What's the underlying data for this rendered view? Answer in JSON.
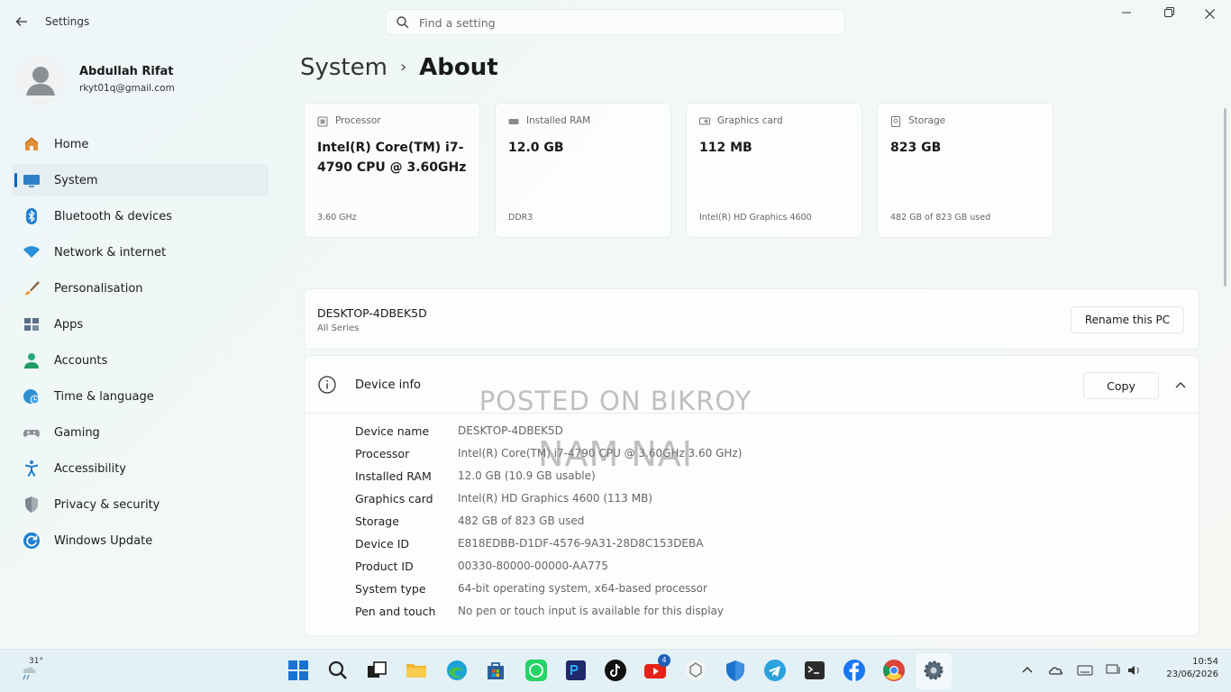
{
  "window": {
    "app_title": "Settings",
    "search_placeholder": "Find a setting"
  },
  "profile": {
    "name": "Abdullah Rifat",
    "email": "rkyt01q@gmail.com"
  },
  "sidebar": {
    "items": [
      {
        "label": "Home",
        "icon": "home-icon"
      },
      {
        "label": "System",
        "icon": "system-icon",
        "active": true
      },
      {
        "label": "Bluetooth & devices",
        "icon": "bluetooth-icon"
      },
      {
        "label": "Network & internet",
        "icon": "wifi-icon"
      },
      {
        "label": "Personalisation",
        "icon": "brush-icon"
      },
      {
        "label": "Apps",
        "icon": "apps-icon"
      },
      {
        "label": "Accounts",
        "icon": "accounts-icon"
      },
      {
        "label": "Time & language",
        "icon": "globe-clock-icon"
      },
      {
        "label": "Gaming",
        "icon": "gamepad-icon"
      },
      {
        "label": "Accessibility",
        "icon": "accessibility-icon"
      },
      {
        "label": "Privacy & security",
        "icon": "shield-icon"
      },
      {
        "label": "Windows Update",
        "icon": "update-icon"
      }
    ]
  },
  "breadcrumb": {
    "parent": "System",
    "separator": "›",
    "current": "About"
  },
  "spec_cards": [
    {
      "label": "Processor",
      "value": "Intel(R) Core(TM) i7-4790 CPU @ 3.60GHz",
      "sub": "3.60 GHz",
      "icon": "processor-icon"
    },
    {
      "label": "Installed RAM",
      "value": "12.0 GB",
      "sub": "DDR3",
      "icon": "ram-icon"
    },
    {
      "label": "Graphics card",
      "value": "112 MB",
      "sub": "Intel(R) HD Graphics 4600",
      "icon": "graphics-card-icon"
    },
    {
      "label": "Storage",
      "value": "823 GB",
      "sub": "482 GB of 823 GB used",
      "icon": "storage-icon"
    }
  ],
  "pc": {
    "name": "DESKTOP-4DBEK5D",
    "series": "All Series",
    "rename_label": "Rename this PC"
  },
  "device_info": {
    "title": "Device info",
    "copy_label": "Copy",
    "rows": [
      {
        "key": "Device name",
        "value": "DESKTOP-4DBEK5D"
      },
      {
        "key": "Processor",
        "value": "Intel(R) Core(TM) i7-4790 CPU @ 3.60GHz   3.60 GHz)"
      },
      {
        "key": "Installed RAM",
        "value": "12.0 GB (10.9 GB usable)"
      },
      {
        "key": "Graphics card",
        "value": "Intel(R) HD Graphics 4600 (113 MB)"
      },
      {
        "key": "Storage",
        "value": "482 GB of 823 GB used"
      },
      {
        "key": "Device ID",
        "value": "E818EDBB-D1DF-4576-9A31-28D8C153DEBA"
      },
      {
        "key": "Product ID",
        "value": "00330-80000-00000-AA775"
      },
      {
        "key": "System type",
        "value": "64-bit operating system, x64-based processor"
      },
      {
        "key": "Pen and touch",
        "value": "No pen or touch input is available for this display"
      }
    ]
  },
  "watermark": {
    "line1": "POSTED ON BIKROY",
    "line2": "NAM NAI"
  },
  "taskbar": {
    "weather_temp": "31°",
    "apps": [
      "start-icon",
      "search-icon",
      "task-view-icon",
      "file-explorer-icon",
      "edge-icon",
      "store-icon",
      "whatsapp-icon",
      "photoshop-icon",
      "tiktok-icon",
      "youtube-icon",
      "chatgpt-icon",
      "defender-icon",
      "telegram-icon",
      "terminal-icon",
      "facebook-icon",
      "chrome-icon",
      "settings-icon"
    ],
    "youtube_badge": "4",
    "time": "10:54",
    "date": "23/06/2026"
  },
  "colors": {
    "accent": "#0067c0"
  }
}
